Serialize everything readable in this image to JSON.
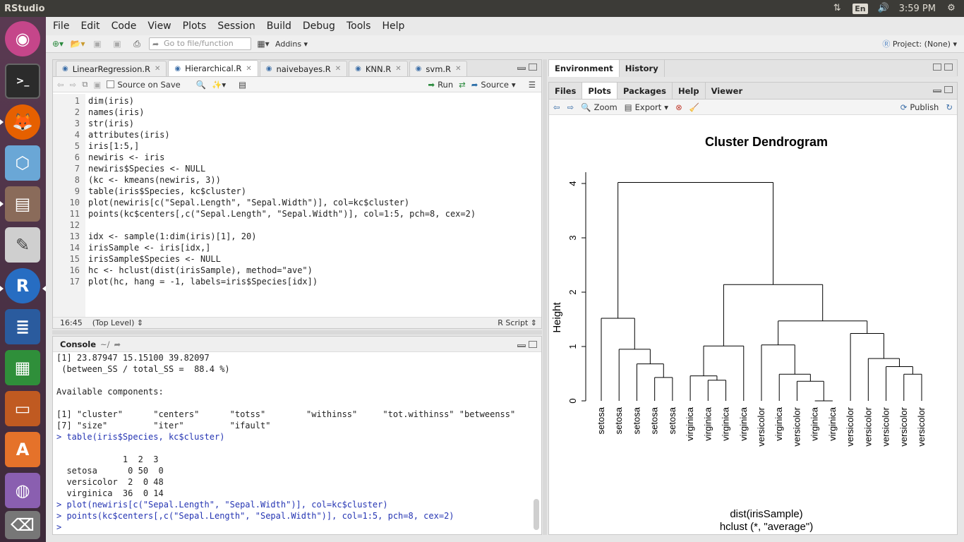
{
  "topbar": {
    "app_title": "RStudio",
    "lang": "En",
    "clock": "3:59 PM"
  },
  "menu": [
    "File",
    "Edit",
    "Code",
    "View",
    "Plots",
    "Session",
    "Build",
    "Debug",
    "Tools",
    "Help"
  ],
  "toolbar": {
    "goto_placeholder": "Go to file/function",
    "addins": "Addins",
    "project": "Project: (None)"
  },
  "editor": {
    "tabs": [
      {
        "label": "LinearRegression.R",
        "active": false
      },
      {
        "label": "Hierarchical.R",
        "active": true
      },
      {
        "label": "naivebayes.R",
        "active": false
      },
      {
        "label": "KNN.R",
        "active": false
      },
      {
        "label": "svm.R",
        "active": false
      }
    ],
    "source_on_save": "Source on Save",
    "run": "Run",
    "source": "Source",
    "lines": [
      "dim(iris)",
      "names(iris)",
      "str(iris)",
      "attributes(iris)",
      "iris[1:5,]",
      "newiris <- iris",
      "newiris$Species <- NULL",
      "(kc <- kmeans(newiris, 3))",
      "table(iris$Species, kc$cluster)",
      "plot(newiris[c(\"Sepal.Length\", \"Sepal.Width\")], col=kc$cluster)",
      "points(kc$centers[,c(\"Sepal.Length\", \"Sepal.Width\")], col=1:5, pch=8, cex=2)",
      "",
      "idx <- sample(1:dim(iris)[1], 20)",
      "irisSample <- iris[idx,]",
      "irisSample$Species <- NULL",
      "hc <- hclust(dist(irisSample), method=\"ave\")",
      "plot(hc, hang = -1, labels=iris$Species[idx])"
    ],
    "status_pos": "16:45",
    "status_scope": "(Top Level)",
    "status_type": "R Script"
  },
  "console": {
    "title": "Console",
    "path": "~/",
    "lines": [
      {
        "text": "[1] 23.87947 15.15100 39.82097",
        "cmd": false
      },
      {
        "text": " (between_SS / total_SS =  88.4 %)",
        "cmd": false
      },
      {
        "text": "",
        "cmd": false
      },
      {
        "text": "Available components:",
        "cmd": false
      },
      {
        "text": "",
        "cmd": false
      },
      {
        "text": "[1] \"cluster\"      \"centers\"      \"totss\"        \"withinss\"     \"tot.withinss\" \"betweenss\"",
        "cmd": false
      },
      {
        "text": "[7] \"size\"         \"iter\"         \"ifault\"",
        "cmd": false
      },
      {
        "text": "> table(iris$Species, kc$cluster)",
        "cmd": true
      },
      {
        "text": "",
        "cmd": false
      },
      {
        "text": "             1  2  3",
        "cmd": false
      },
      {
        "text": "  setosa      0 50  0",
        "cmd": false
      },
      {
        "text": "  versicolor  2  0 48",
        "cmd": false
      },
      {
        "text": "  virginica  36  0 14",
        "cmd": false
      },
      {
        "text": "> plot(newiris[c(\"Sepal.Length\", \"Sepal.Width\")], col=kc$cluster)",
        "cmd": true
      },
      {
        "text": "> points(kc$centers[,c(\"Sepal.Length\", \"Sepal.Width\")], col=1:5, pch=8, cex=2)",
        "cmd": true
      },
      {
        "text": "> ",
        "cmd": true
      }
    ]
  },
  "env_tabs": [
    "Environment",
    "History"
  ],
  "files_tabs": [
    "Files",
    "Plots",
    "Packages",
    "Help",
    "Viewer"
  ],
  "plots_toolbar": {
    "zoom": "Zoom",
    "export": "Export",
    "publish": "Publish"
  },
  "chart_data": {
    "type": "dendrogram",
    "title": "Cluster Dendrogram",
    "ylabel": "Height",
    "xlabel": "dist(irisSample)",
    "sublabel": "hclust (*, \"average\")",
    "ylim": [
      0,
      4
    ],
    "yticks": [
      0,
      1,
      2,
      3,
      4
    ],
    "leaves": [
      "setosa",
      "setosa",
      "setosa",
      "setosa",
      "setosa",
      "virginica",
      "virginica",
      "virginica",
      "virginica",
      "versicolor",
      "virginica",
      "versicolor",
      "virginica",
      "virginica",
      "versicolor",
      "versicolor",
      "versicolor",
      "versicolor",
      "versicolor"
    ],
    "merges": [
      {
        "id": "A",
        "left": "L3",
        "right": "L4",
        "height": 0.43
      },
      {
        "id": "B",
        "left": "L2",
        "right": "A",
        "height": 0.68
      },
      {
        "id": "C",
        "left": "L1",
        "right": "B",
        "height": 0.95
      },
      {
        "id": "D",
        "left": "L0",
        "right": "C",
        "height": 1.52
      },
      {
        "id": "E",
        "left": "L6",
        "right": "L7",
        "height": 0.38
      },
      {
        "id": "F",
        "left": "L5",
        "right": "E",
        "height": 0.46
      },
      {
        "id": "G",
        "left": "F",
        "right": "L8",
        "height": 1.01
      },
      {
        "id": "H",
        "left": "L12",
        "right": "L13",
        "height": 0.0
      },
      {
        "id": "I",
        "left": "L11",
        "right": "H",
        "height": 0.36
      },
      {
        "id": "J",
        "left": "L10",
        "right": "I",
        "height": 0.49
      },
      {
        "id": "K",
        "left": "L9",
        "right": "J",
        "height": 1.03
      },
      {
        "id": "L",
        "left": "L17",
        "right": "L18",
        "height": 0.49
      },
      {
        "id": "M",
        "left": "L16",
        "right": "L",
        "height": 0.63
      },
      {
        "id": "N",
        "left": "L15",
        "right": "M",
        "height": 0.78
      },
      {
        "id": "O",
        "left": "L14",
        "right": "N",
        "height": 1.24
      },
      {
        "id": "P",
        "left": "K",
        "right": "O",
        "height": 1.47
      },
      {
        "id": "Q",
        "left": "G",
        "right": "P",
        "height": 2.14
      },
      {
        "id": "R",
        "left": "D",
        "right": "Q",
        "height": 4.02
      }
    ]
  }
}
